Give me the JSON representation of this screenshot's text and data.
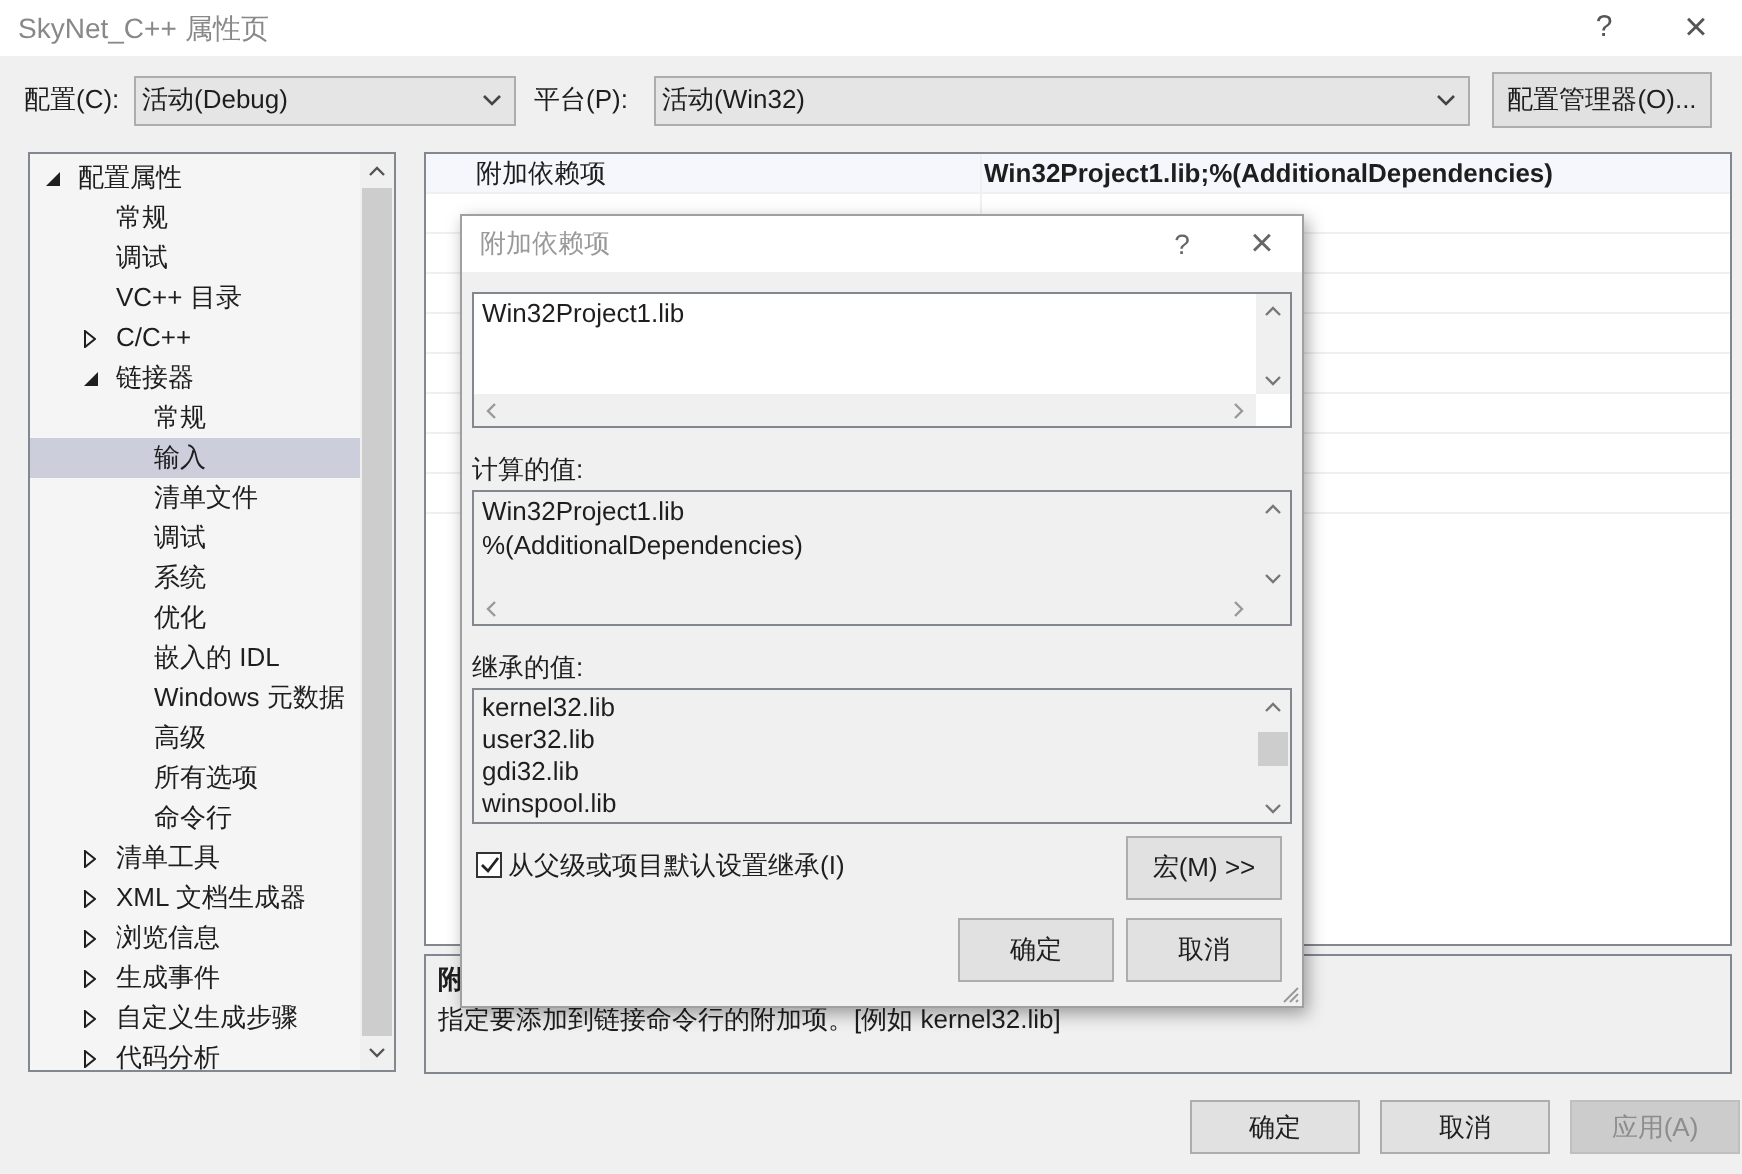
{
  "window": {
    "title": "SkyNet_C++ 属性页",
    "help": "?",
    "close": "×"
  },
  "toolbar": {
    "config_label": "配置(C):",
    "config_value": "活动(Debug)",
    "platform_label": "平台(P):",
    "platform_value": "活动(Win32)",
    "manager_button": "配置管理器(O)..."
  },
  "tree": [
    {
      "label": "配置属性",
      "expanded": true,
      "selected": false,
      "children": [
        {
          "label": "常规",
          "selected": false
        },
        {
          "label": "调试",
          "selected": false
        },
        {
          "label": "VC++ 目录",
          "selected": false
        },
        {
          "label": "C/C++",
          "expanded": false,
          "selected": false
        },
        {
          "label": "链接器",
          "expanded": true,
          "selected": false,
          "children": [
            {
              "label": "常规",
              "selected": false
            },
            {
              "label": "输入",
              "selected": true
            },
            {
              "label": "清单文件",
              "selected": false
            },
            {
              "label": "调试",
              "selected": false
            },
            {
              "label": "系统",
              "selected": false
            },
            {
              "label": "优化",
              "selected": false
            },
            {
              "label": "嵌入的 IDL",
              "selected": false
            },
            {
              "label": "Windows 元数据",
              "selected": false
            },
            {
              "label": "高级",
              "selected": false
            },
            {
              "label": "所有选项",
              "selected": false
            },
            {
              "label": "命令行",
              "selected": false
            }
          ]
        },
        {
          "label": "清单工具",
          "expanded": false,
          "selected": false
        },
        {
          "label": "XML 文档生成器",
          "expanded": false,
          "selected": false
        },
        {
          "label": "浏览信息",
          "expanded": false,
          "selected": false
        },
        {
          "label": "生成事件",
          "expanded": false,
          "selected": false
        },
        {
          "label": "自定义生成步骤",
          "expanded": false,
          "selected": false
        },
        {
          "label": "代码分析",
          "expanded": false,
          "selected": false
        }
      ]
    }
  ],
  "properties": [
    {
      "name": "附加依赖项",
      "value": "Win32Project1.lib;%(AdditionalDependencies)"
    }
  ],
  "description": {
    "title": "附",
    "text": "指定要添加到链接命令行的附加项。[例如 kernel32.lib]"
  },
  "buttons": [
    {
      "label": "确定",
      "disabled": false
    },
    {
      "label": "取消",
      "disabled": false
    },
    {
      "label": "应用(A)",
      "disabled": true
    }
  ],
  "dialog": {
    "title": "附加依赖项",
    "help": "?",
    "close": "×",
    "edit_lines": [
      "Win32Project1.lib"
    ],
    "computed_label": "计算的值:",
    "computed_lines": [
      "Win32Project1.lib",
      "%(AdditionalDependencies)"
    ],
    "inherited_label": "继承的值:",
    "inherited_lines": [
      "kernel32.lib",
      "user32.lib",
      "gdi32.lib",
      "winspool.lib"
    ],
    "inherit_checkbox": {
      "label": "从父级或项目默认设置继承(I)",
      "checked": true
    },
    "macro_button": "宏(M) >>",
    "ok_button": "确定",
    "cancel_button": "取消"
  }
}
